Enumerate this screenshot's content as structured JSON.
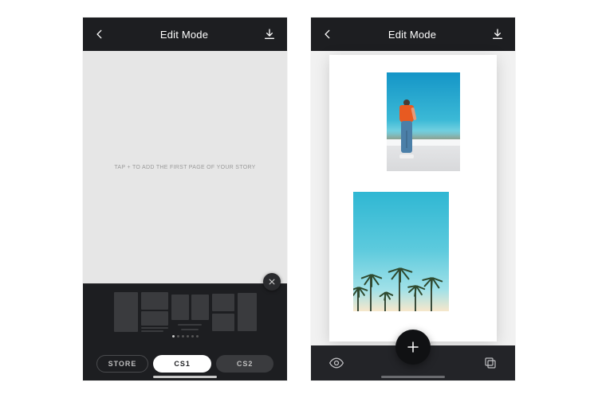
{
  "screens": {
    "left": {
      "header": {
        "title": "Edit Mode"
      },
      "empty_hint": "TAP + TO ADD THE FIRST PAGE OF YOUR STORY",
      "tabs": {
        "store": "STORE",
        "active": "CS1",
        "inactive": "CS2"
      }
    },
    "right": {
      "header": {
        "title": "Edit Mode"
      }
    }
  },
  "icons": {
    "back": "back-icon",
    "download": "download-icon",
    "close": "close-icon",
    "eye": "eye-icon",
    "plus": "plus-icon",
    "copy": "copy-icon"
  },
  "colors": {
    "header_bg": "#1d1e21",
    "canvas_bg": "#e6e6e6",
    "accent_shirt": "#e85a21",
    "accent_jeans": "#4b7fa8",
    "sky_top": "#2fb7d3"
  }
}
